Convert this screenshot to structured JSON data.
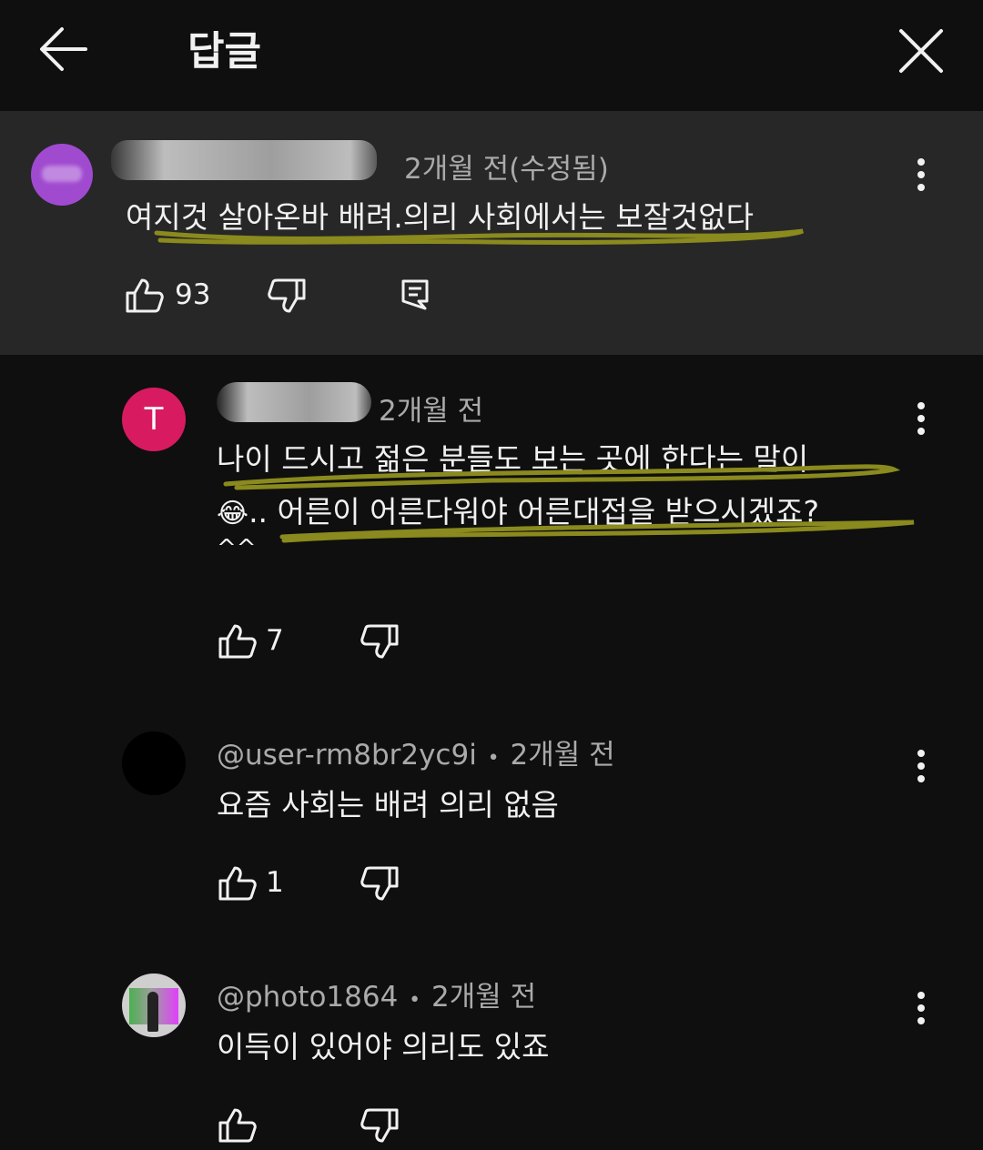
{
  "header": {
    "title": "답글",
    "back_icon": "arrow-left-icon",
    "close_icon": "close-icon"
  },
  "parent_comment": {
    "time": "2개월 전(수정됨)",
    "text": "여지것 살아온바 배려.의리 사회에서는 보잘것없다",
    "likes": "93",
    "avatar_color": "#a04ad0"
  },
  "replies": [
    {
      "avatar_letter": "T",
      "avatar_color": "#d81b60",
      "time": "2개월 전",
      "line1": "나이 드시고 젊은 분들도 보는 곳에 한다는 말이",
      "emoji": "😂",
      "line2": ".. 어른이 어른다워야 어른대접을 받으시겠죠?",
      "line3": "^^",
      "likes": "7"
    },
    {
      "author": "@user-rm8br2yc9i",
      "sep": "•",
      "time": "2개월 전",
      "text": "요즘 사회는 배려 의리 없음",
      "likes": "1",
      "avatar_color": "#000000"
    },
    {
      "author": "@photo1864",
      "sep": "•",
      "time": "2개월 전",
      "text": "이득이 있어야 의리도 있죠",
      "likes": ""
    }
  ],
  "colors": {
    "background": "#0f0f0f",
    "parent_background": "#272727",
    "highlight": "#8a8a1e"
  }
}
